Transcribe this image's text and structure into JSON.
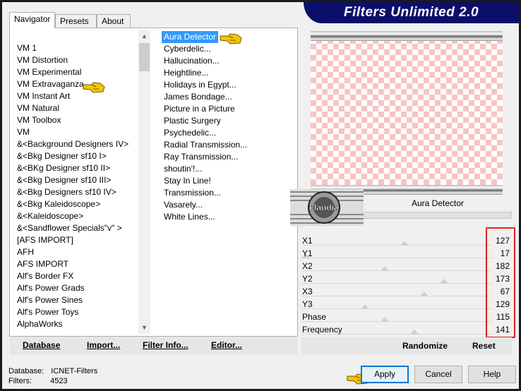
{
  "banner": {
    "title": "Filters Unlimited 2.0"
  },
  "tabs": [
    {
      "label": "Navigator",
      "active": true
    },
    {
      "label": "Presets",
      "active": false
    },
    {
      "label": "About",
      "active": false
    }
  ],
  "categories": {
    "selected": "VM Extravaganza",
    "items": [
      "VM 1",
      "VM Distortion",
      "VM Experimental",
      "VM Extravaganza",
      "VM Instant Art",
      "VM Natural",
      "VM Toolbox",
      "VM",
      "&<Background Designers IV>",
      "&<Bkg Designer sf10 I>",
      "&<BKg Designer sf10 II>",
      "&<Bkg Designer sf10 III>",
      "&<Bkg Designers sf10 IV>",
      "&<Bkg Kaleidoscope>",
      "&<Kaleidoscope>",
      "&<Sandflower Specials\"v\" >",
      "[AFS IMPORT]",
      "AFH",
      "AFS IMPORT",
      "Alf's Border FX",
      "Alf's Power Grads",
      "Alf's Power Sines",
      "Alf's Power Toys",
      "AlphaWorks"
    ]
  },
  "filters": {
    "selected": "Aura Detector",
    "items": [
      "Aura Detector",
      "Cyberdelic...",
      "Hallucination...",
      "Heightline...",
      "Holidays in Egypt...",
      "James Bondage...",
      "Picture in a Picture",
      "Plastic Surgery",
      "Psychedelic...",
      "Radial Transmission...",
      "Ray Transmission...",
      "shoutin'!...",
      "Stay In Line!",
      "Transmission...",
      "Vasarely...",
      "White Lines..."
    ]
  },
  "bottom_bar": {
    "database": "Database",
    "import": "Import...",
    "filter_info": "Filter Info...",
    "editor": "Editor..."
  },
  "preview": {
    "filter_name": "Aura Detector",
    "watermark": "claudia"
  },
  "parameters": [
    {
      "label": "X1",
      "value": "127"
    },
    {
      "label": "Y1",
      "value": "17"
    },
    {
      "label": "X2",
      "value": "182"
    },
    {
      "label": "Y2",
      "value": "173"
    },
    {
      "label": "X3",
      "value": "67"
    },
    {
      "label": "Y3",
      "value": "129"
    },
    {
      "label": "Phase",
      "value": "115"
    },
    {
      "label": "Frequency",
      "value": "141"
    }
  ],
  "param_buttons": {
    "randomize": "Randomize",
    "reset": "Reset"
  },
  "status": {
    "database_label": "Database:",
    "database_value": "ICNET-Filters",
    "filters_label": "Filters:",
    "filters_value": "4523"
  },
  "buttons": {
    "apply": "Apply",
    "cancel": "Cancel",
    "help": "Help"
  },
  "colors": {
    "banner": "#0b0f6a",
    "selection": "#3399ff",
    "highlight_box": "#e02020",
    "checker": "#f8c4c4"
  }
}
